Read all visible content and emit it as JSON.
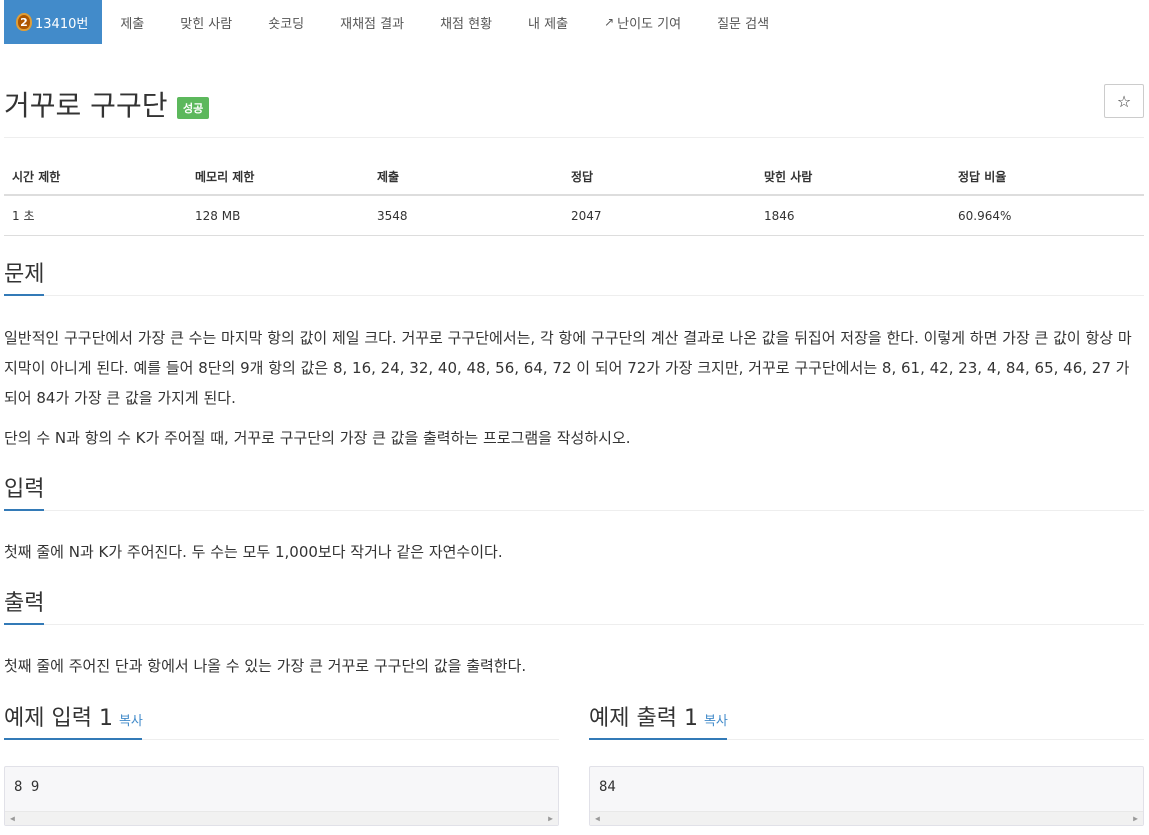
{
  "nav": {
    "problem_id": "13410번",
    "tier_number": "2",
    "items": [
      "제출",
      "맞힌 사람",
      "숏코딩",
      "재채점 결과",
      "채점 현황",
      "내 제출",
      "난이도 기여",
      "질문 검색"
    ]
  },
  "problem": {
    "title": "거꾸로 구구단",
    "status": "성공",
    "star_icon": "☆"
  },
  "info": {
    "headers": [
      "시간 제한",
      "메모리 제한",
      "제출",
      "정답",
      "맞힌 사람",
      "정답 비율"
    ],
    "values": [
      "1 초",
      "128 MB",
      "3548",
      "2047",
      "1846",
      "60.964%"
    ]
  },
  "sections": {
    "description_title": "문제",
    "description_p1": "일반적인 구구단에서 가장 큰 수는 마지막 항의 값이 제일 크다. 거꾸로 구구단에서는, 각 항에 구구단의 계산 결과로 나온 값을 뒤집어 저장을 한다. 이렇게 하면 가장 큰 값이 항상 마지막이 아니게 된다. 예를 들어 8단의 9개 항의 값은 8, 16, 24, 32, 40, 48, 56, 64, 72 이 되어 72가 가장 크지만, 거꾸로 구구단에서는 8, 61, 42, 23, 4, 84, 65, 46, 27 가 되어 84가 가장 큰 값을 가지게 된다.",
    "description_p2": "단의 수 N과 항의 수 K가 주어질 때, 거꾸로 구구단의 가장 큰 값을 출력하는 프로그램을 작성하시오.",
    "input_title": "입력",
    "input_text": "첫째 줄에 N과 K가 주어진다. 두 수는 모두 1,000보다 작거나 같은 자연수이다.",
    "output_title": "출력",
    "output_text": "첫째 줄에 주어진 단과 항에서 나올 수 있는 가장 큰 거꾸로 구구단의 값을 출력한다."
  },
  "samples": {
    "input_title": "예제 입력 1",
    "output_title": "예제 출력 1",
    "copy_label": "복사",
    "input_value": "8 9",
    "output_value": "84"
  },
  "colors": {
    "accent": "#428bca",
    "success": "#5cb85c",
    "section_underline": "#337ab7"
  }
}
